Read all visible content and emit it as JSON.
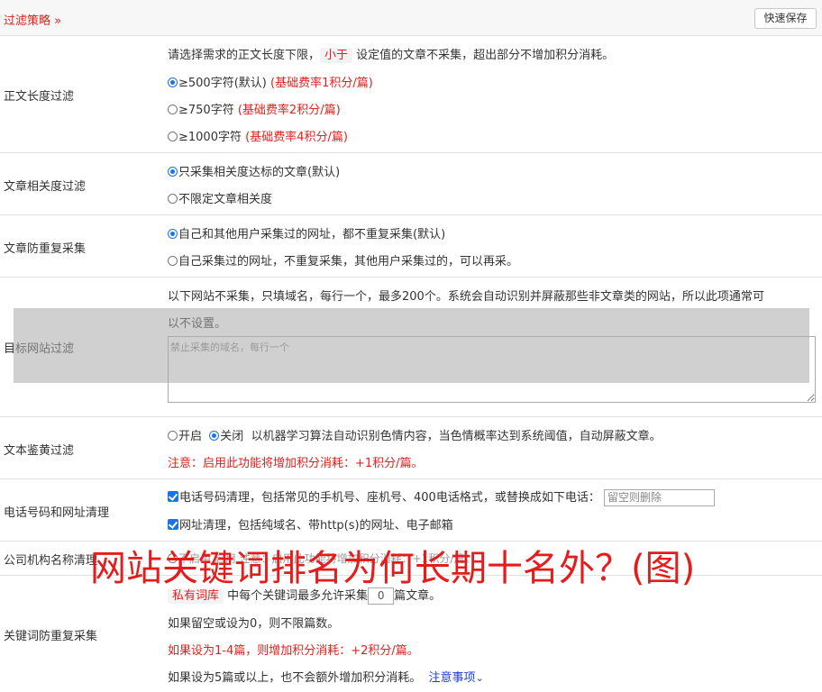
{
  "header": {
    "title": "过滤策略 »",
    "save_label": "快速保存"
  },
  "length": {
    "label": "正文长度过滤",
    "desc_a": "请选择需求的正文长度下限，",
    "desc_pill": "小于",
    "desc_b": "设定值的文章不采集，超出部分不增加积分消耗。",
    "opt1": "≥500字符(默认)",
    "opt1_note": "(基础费率1积分/篇)",
    "opt2": "≥750字符",
    "opt2_note": "(基础费率2积分/篇)",
    "opt3": "≥1000字符",
    "opt3_note": "(基础费率4积分/篇)"
  },
  "relevance": {
    "label": "文章相关度过滤",
    "opt1": "只采集相关度达标的文章(默认)",
    "opt2": "不限定文章相关度"
  },
  "dedupe": {
    "label": "文章防重复采集",
    "opt1": "自己和其他用户采集过的网址，都不重复采集(默认)",
    "opt2": "自己采集过的网址，不重复采集，其他用户采集过的，可以再采。"
  },
  "target": {
    "label": "目标网站过滤",
    "desc1": "以下网站不采集，只填域名，每行一个，最多200个。系统会自动识别并屏蔽那些非文章类的网站，所以此项通常可",
    "desc2": "以不设置。",
    "placeholder": "禁止采集的域名，每行一个"
  },
  "porn": {
    "label": "文本鉴黄过滤",
    "on": "开启",
    "off": "关闭",
    "desc": "以机器学习算法自动识别色情内容，当色情概率达到系统阈值，自动屏蔽文章。",
    "note": "注意：启用此功能将增加积分消耗：+1积分/篇。"
  },
  "phone": {
    "label": "电话号码和网址清理",
    "opt1": "电话号码清理，包括常见的手机号、座机号、400电话格式，或替换成如下电话：",
    "input_placeholder": "留空则删除",
    "opt2": "网址清理，包括纯域名、带http(s)的网址、电子邮箱"
  },
  "company": {
    "label": "公司机构名称清理",
    "partial": "不启用  启用  注意：启用此功能将增加积分消耗：+1积分/篇。"
  },
  "keyword": {
    "label": "关键词防重复采集",
    "pill": "私有词库",
    "line1_a": "中每个关键词最多允许采集",
    "count": "0",
    "line1_b": "篇文章。",
    "line2": "如果留空或设为0，则不限篇数。",
    "line3": "如果设为1-4篇，则增加积分消耗：+2积分/篇。",
    "line4": "如果设为5篇或以上，也不会额外增加积分消耗。",
    "link": "注意事项"
  },
  "watermark": "网站关键词排名为何长期十名外？(图)"
}
